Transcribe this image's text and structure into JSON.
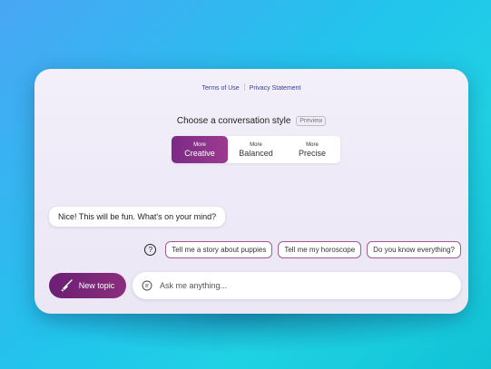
{
  "links": {
    "terms": "Terms of Use",
    "privacy": "Privacy Statement"
  },
  "conversation_style": {
    "title": "Choose a conversation style",
    "badge": "Preview",
    "options": [
      {
        "top": "More",
        "label": "Creative",
        "selected": true
      },
      {
        "top": "More",
        "label": "Balanced",
        "selected": false
      },
      {
        "top": "More",
        "label": "Precise",
        "selected": false
      }
    ]
  },
  "chat": {
    "greeting": "Nice! This will be fun. What's on your mind?"
  },
  "suggestions": {
    "help_icon": "question-circle-icon",
    "items": [
      "Tell me a story about puppies",
      "Tell me my horoscope",
      "Do you know everything?"
    ]
  },
  "composer": {
    "new_topic_label": "New topic",
    "new_topic_icon": "broom-icon",
    "input_icon": "chat-icon",
    "placeholder": "Ask me anything..."
  },
  "colors": {
    "accent": "#7c2a86",
    "background": "#22c3ec"
  }
}
